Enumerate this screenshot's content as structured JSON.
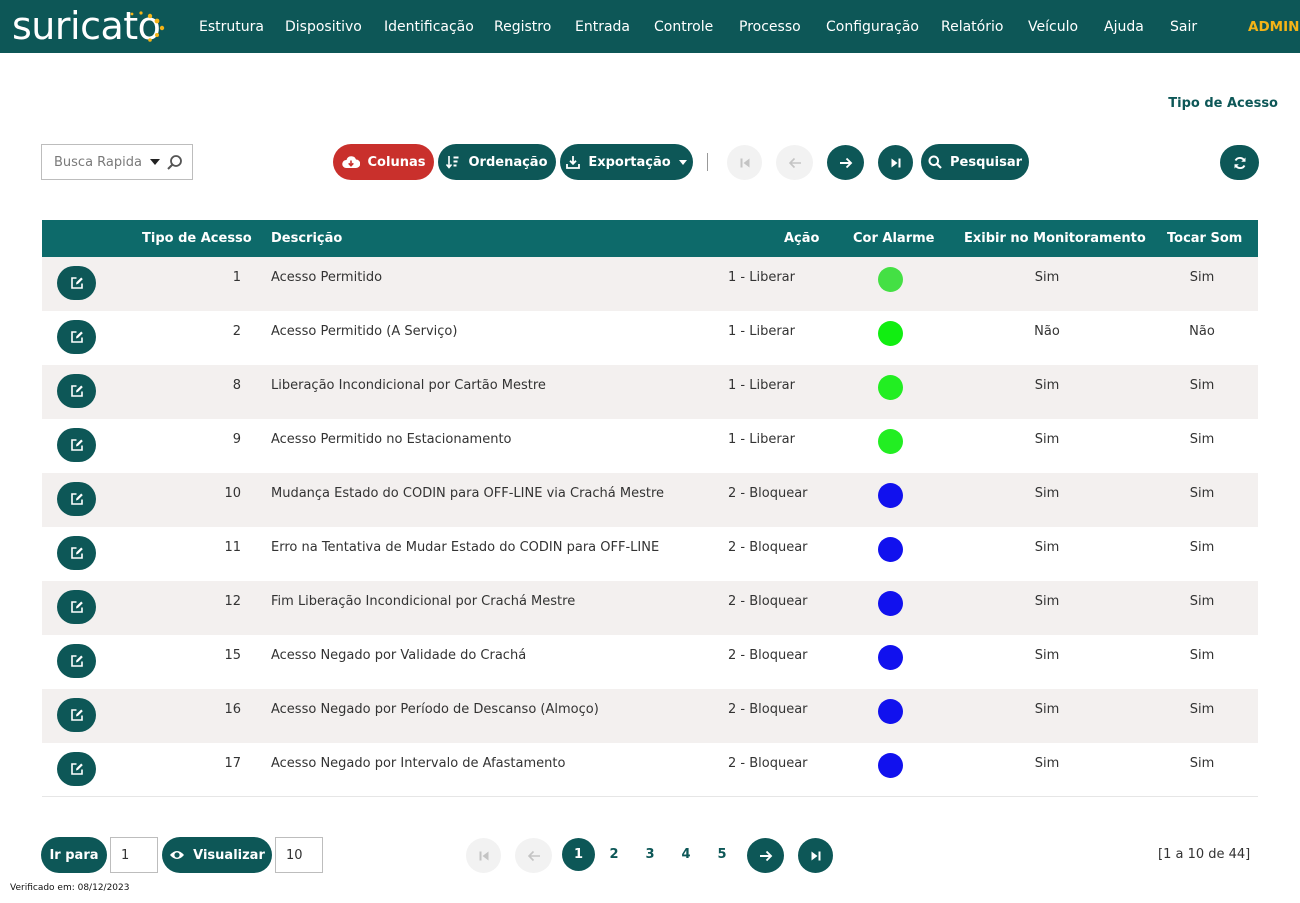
{
  "brand": {
    "name": "suricato"
  },
  "nav": {
    "items": [
      "Estrutura",
      "Dispositivo",
      "Identificação",
      "Registro",
      "Entrada",
      "Controle",
      "Processo",
      "Configuração",
      "Relatório",
      "Veículo",
      "Ajuda",
      "Sair"
    ],
    "user": "ADMIN"
  },
  "page": {
    "title": "Tipo de Acesso"
  },
  "toolbar": {
    "search_placeholder": "Busca Rapida",
    "columns": "Colunas",
    "sort": "Ordenação",
    "export": "Exportação",
    "search": "Pesquisar"
  },
  "table": {
    "headers": [
      "Tipo de Acesso",
      "Descrição",
      "Ação",
      "Cor Alarme",
      "Exibir no Monitoramento",
      "Tocar Som"
    ],
    "rows": [
      {
        "tipo": "1",
        "descricao": "Acesso Permitido",
        "acao": "1 - Liberar",
        "cor": "#44e044",
        "exibir": "Sim",
        "som": "Sim"
      },
      {
        "tipo": "2",
        "descricao": "Acesso Permitido (A Serviço)",
        "acao": "1 - Liberar",
        "cor": "#11ee11",
        "exibir": "Não",
        "som": "Não"
      },
      {
        "tipo": "8",
        "descricao": "Liberação Incondicional por Cartão Mestre",
        "acao": "1 - Liberar",
        "cor": "#22ee22",
        "exibir": "Sim",
        "som": "Sim"
      },
      {
        "tipo": "9",
        "descricao": "Acesso Permitido no Estacionamento",
        "acao": "1 - Liberar",
        "cor": "#22ee22",
        "exibir": "Sim",
        "som": "Sim"
      },
      {
        "tipo": "10",
        "descricao": "Mudança Estado do CODIN para OFF-LINE via Crachá Mestre",
        "acao": "2 - Bloquear",
        "cor": "#1111ee",
        "exibir": "Sim",
        "som": "Sim"
      },
      {
        "tipo": "11",
        "descricao": "Erro na Tentativa de Mudar Estado do CODIN para OFF-LINE",
        "acao": "2 - Bloquear",
        "cor": "#1111ee",
        "exibir": "Sim",
        "som": "Sim"
      },
      {
        "tipo": "12",
        "descricao": "Fim Liberação Incondicional por Crachá Mestre",
        "acao": "2 - Bloquear",
        "cor": "#1111ee",
        "exibir": "Sim",
        "som": "Sim"
      },
      {
        "tipo": "15",
        "descricao": "Acesso Negado por Validade do Crachá",
        "acao": "2 - Bloquear",
        "cor": "#1111ee",
        "exibir": "Sim",
        "som": "Sim"
      },
      {
        "tipo": "16",
        "descricao": "Acesso Negado por Período de Descanso (Almoço)",
        "acao": "2 - Bloquear",
        "cor": "#1111ee",
        "exibir": "Sim",
        "som": "Sim"
      },
      {
        "tipo": "17",
        "descricao": "Acesso Negado por Intervalo de Afastamento",
        "acao": "2 - Bloquear",
        "cor": "#1111ee",
        "exibir": "Sim",
        "som": "Sim"
      }
    ]
  },
  "footer": {
    "goto_label": "Ir para",
    "goto_value": "1",
    "view_label": "Visualizar",
    "view_value": "10",
    "pages": [
      "1",
      "2",
      "3",
      "4",
      "5"
    ],
    "current_page": "1",
    "range_text": "[1 a 10 de 44]",
    "verified": "Verificado em: 08/12/2023"
  }
}
